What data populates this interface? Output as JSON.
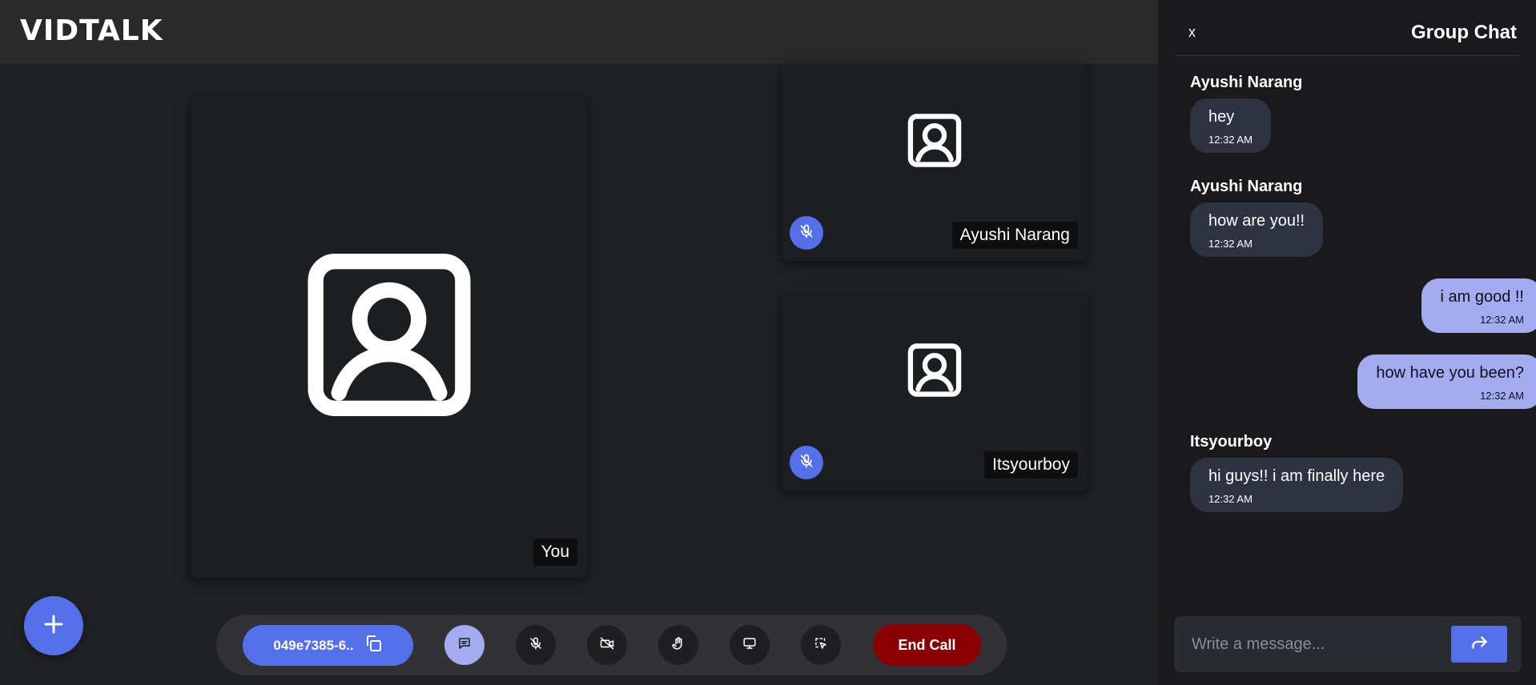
{
  "app": {
    "logo": "VIDTALK"
  },
  "participants": {
    "self": {
      "name": "You"
    },
    "others": [
      {
        "name": "Ayushi Narang",
        "muted": true
      },
      {
        "name": "Itsyourboy",
        "muted": true
      }
    ]
  },
  "controls": {
    "meeting_id": "049e7385-6..",
    "end_call_label": "End Call",
    "chat_active": true
  },
  "chat": {
    "close_label": "x",
    "title": "Group Chat",
    "messages": [
      {
        "sender": "Ayushi Narang",
        "text": "hey",
        "time": "12:32 AM",
        "direction": "in"
      },
      {
        "sender": "Ayushi Narang",
        "text": "how are you!!",
        "time": "12:32 AM",
        "direction": "in"
      },
      {
        "sender": "",
        "text": "i am good !!",
        "time": "12:32 AM",
        "direction": "out"
      },
      {
        "sender": "",
        "text": "how have you been?",
        "time": "12:32 AM",
        "direction": "out"
      },
      {
        "sender": "Itsyourboy",
        "text": "hi guys!! i am finally here",
        "time": "12:32 AM",
        "direction": "in"
      }
    ],
    "input_placeholder": "Write a message..."
  },
  "colors": {
    "accent": "#5470e9",
    "end_call": "#8a0000",
    "outgoing_bubble": "#a4acf0",
    "incoming_bubble": "#2e3241"
  }
}
